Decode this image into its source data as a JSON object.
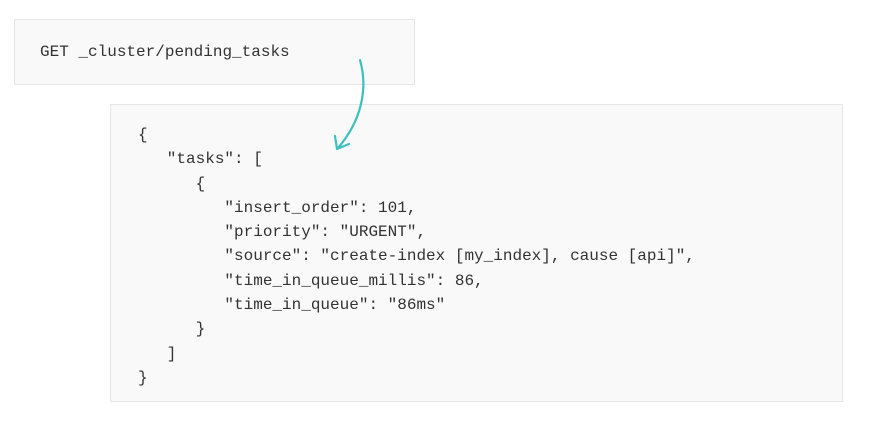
{
  "request": {
    "method": "GET",
    "path": "_cluster/pending_tasks"
  },
  "response": {
    "lines": [
      "{",
      "   \"tasks\": [",
      "      {",
      "         \"insert_order\": 101,",
      "         \"priority\": \"URGENT\",",
      "         \"source\": \"create-index [my_index], cause [api]\",",
      "         \"time_in_queue_millis\": 86,",
      "         \"time_in_queue\": \"86ms\"",
      "      }",
      "   ]",
      "}"
    ]
  },
  "colors": {
    "arrow": "#3dbfbf",
    "panel_bg": "#f9f9f9",
    "panel_border": "#e6e6e6",
    "text": "#333333"
  },
  "icons": {
    "arrow": "curved-arrow-icon"
  }
}
